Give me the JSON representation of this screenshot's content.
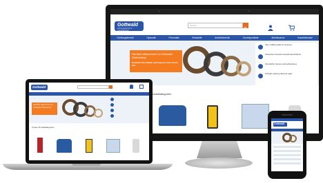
{
  "desktop": {
    "logo": {
      "text": "Gottwald",
      "tagline": "Dichtungstechnik & Industriebedarf"
    },
    "search": {
      "placeholder": "Suchen..."
    },
    "user_label": "Mein Konto",
    "cart_label": "Warenkorb",
    "nav": [
      "Dichtungstechnik",
      "Hydraulik",
      "Pneumatik",
      "Klebstoffe",
      "Antriebstechnik",
      "Gummiprodukte",
      "Arbeitsschutz",
      "Industriebedarf"
    ],
    "hero": {
      "headline": "Herzlich willkommen im Gottwald Onlineshop!",
      "subline": "Bestellen Sie einfach und bequem rund um die Uhr."
    },
    "benefits": [
      "Über 1 Million Artikel im Sortiment",
      "Kostenloser Versand innerhalb Deutschlands",
      "Persönlicher Service und Fachberatung",
      "Schnelle Lieferung direkt ab Lager"
    ],
    "category_title": "Unsere Produktkategorien"
  },
  "colors": {
    "brand_blue": "#2a55a8",
    "accent_orange": "#f47b20",
    "search_orange": "#e66b1d"
  },
  "icons": [
    "search-icon",
    "user-icon",
    "cart-icon",
    "check-circle-icon"
  ]
}
